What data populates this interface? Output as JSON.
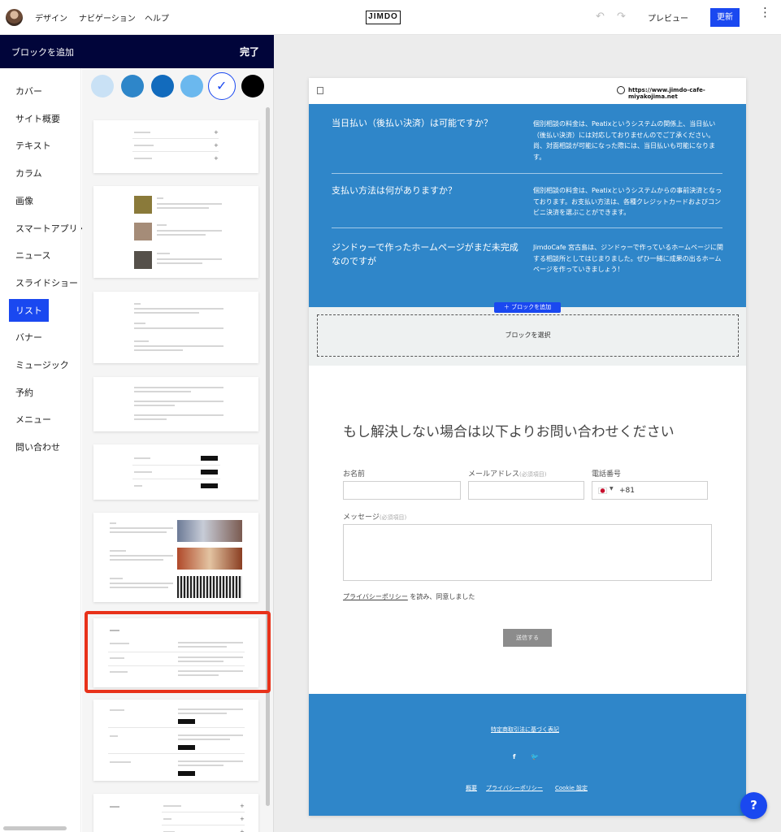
{
  "topbar": {
    "nav": [
      "デザイン",
      "ナビゲーション",
      "ヘルプ"
    ],
    "logo": "JIMDO",
    "preview": "プレビュー",
    "update": "更新",
    "menu_glyph": "⋮",
    "undo_glyph": "↶",
    "redo_glyph": "↷"
  },
  "panel": {
    "title": "ブロックを追加",
    "done": "完了",
    "categories": [
      "カバー",
      "サイト概要",
      "テキスト",
      "カラム",
      "画像",
      "スマートアプリ・",
      "ニュース",
      "スライドショー",
      "リスト",
      "バナー",
      "ミュージック",
      "予約",
      "メニュー",
      "問い合わせ"
    ],
    "active_category": "リスト",
    "swatches": [
      "#c9e1f5",
      "#2e86c9",
      "#126bbd",
      "#6bb8ee",
      "#ffffff",
      "#000000"
    ],
    "selected_swatch_check": "✓"
  },
  "site": {
    "url": "https://www.jimdo-cafe-miyakojima.net",
    "faq": [
      {
        "q": "当日払い（後払い決済）は可能ですか？",
        "a": "個別相談の料金は、Peatixというシステムの関係上、当日払い（後払い決済）には対応しておりませんのでご了承ください。尚、対面相談が可能になった際には、当日払いも可能になります。"
      },
      {
        "q": "支払い方法は何がありますか？",
        "a": "個別相談の料金は、Peatixというシステムからの事前決済となっております。お支払い方法は、各種クレジットカードおよびコンビニ決済を選ぶことができます。"
      },
      {
        "q": "ジンドゥーで作ったホームページがまだ未完成なのですが",
        "a": "JimdoCafe 宮古島は、ジンドゥーで作っているホームページに関する相談所としてはじまりました。ぜひ一緒に成果の出るホームページを作っていきましょう！"
      }
    ],
    "add_block": "＋ ブロックを追加",
    "select_block": "ブロックを選択",
    "contact": {
      "title": "もし解決しない場合は以下よりお問い合わせください",
      "name_label": "お名前",
      "email_label": "メールアドレス",
      "required": "(必須項目)",
      "phone_label": "電話番号",
      "phone_code": "+81",
      "message_label": "メッセージ",
      "privacy_link": "プライバシーポリシー",
      "privacy_text": " を読み、同意しました",
      "send": "送信する"
    },
    "footer": {
      "legal": "特定商取引法に基づく表記",
      "social": [
        "f",
        "🐦"
      ],
      "links": [
        "概要",
        "プライバシーポリシー",
        "Cookie 設定"
      ]
    }
  },
  "help_glyph": "?"
}
